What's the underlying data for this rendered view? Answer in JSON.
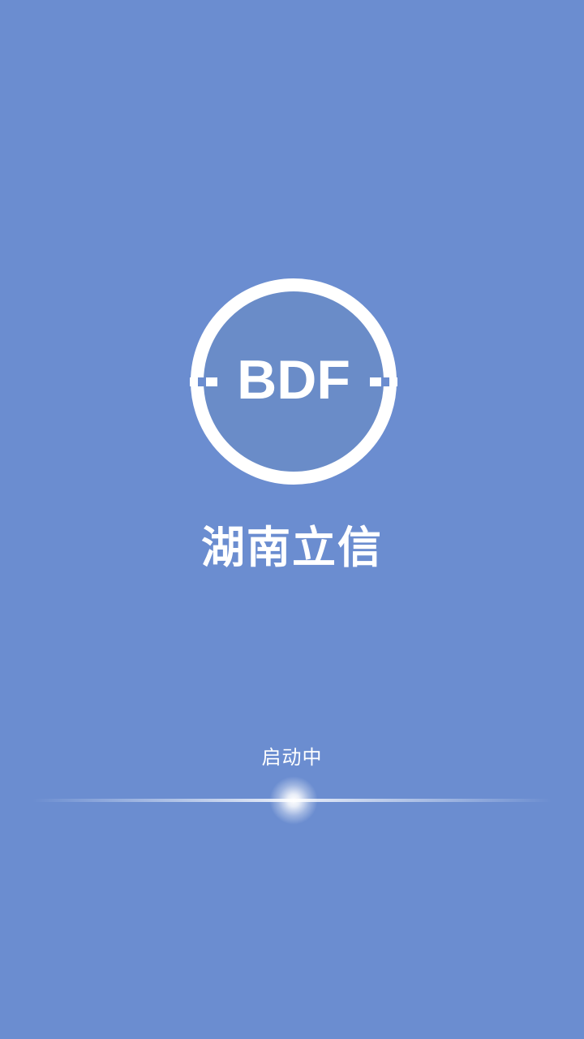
{
  "splash": {
    "logo_text": "BDF",
    "app_name": "湖南立信",
    "status_text": "启动中"
  },
  "colors": {
    "background": "#6b8dd0",
    "logo_inner": "#6a8cc8",
    "foreground": "#ffffff"
  },
  "icons": {
    "logo": "bdf-circle-logo-icon",
    "loading": "loading-progress-glow"
  }
}
